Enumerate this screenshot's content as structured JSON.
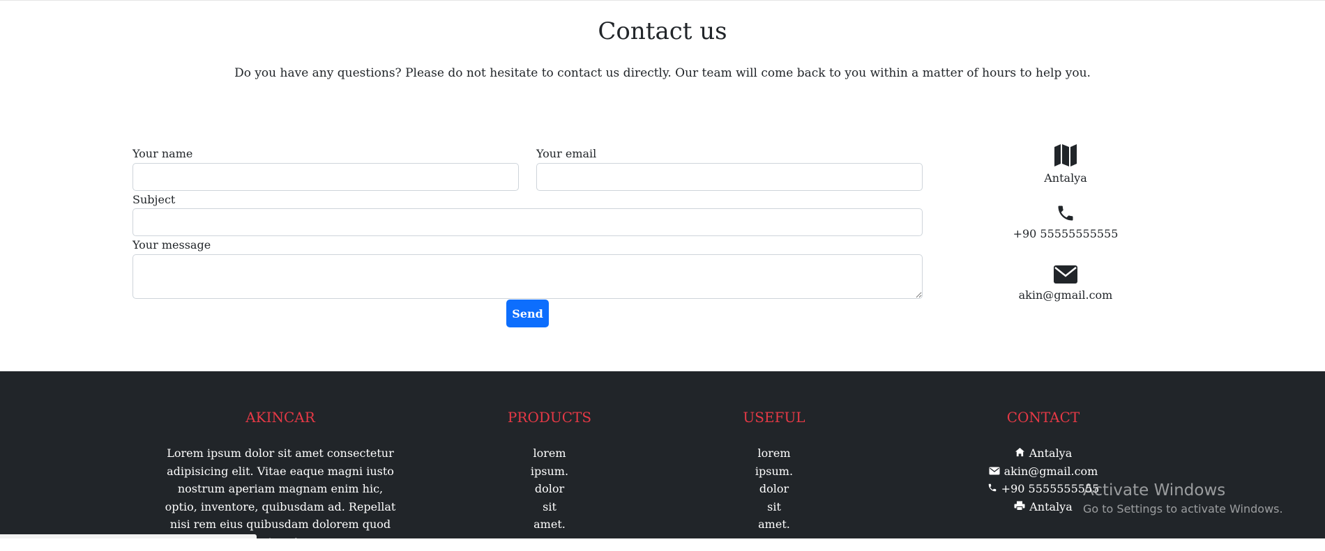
{
  "contact": {
    "title": "Contact us",
    "intro": "Do you have any questions? Please do not hesitate to contact us directly. Our team will come back to you within a matter of hours to help you.",
    "form": {
      "name_label": "Your name",
      "name_value": "",
      "email_label": "Your email",
      "email_value": "",
      "subject_label": "Subject",
      "subject_value": "",
      "message_label": "Your message",
      "message_value": "",
      "send_label": "Send"
    },
    "info": {
      "location": "Antalya",
      "location_icon": "map-icon",
      "phone": "+90 55555555555",
      "phone_icon": "phone-icon",
      "email": "akin@gmail.com",
      "email_icon": "envelope-icon"
    }
  },
  "footer": {
    "about": {
      "heading": "AKINCAR",
      "text": "Lorem ipsum dolor sit amet consectetur adipisicing elit. Vitae eaque magni iusto nostrum aperiam magnam enim hic, optio, inventore, quibusdam ad. Repellat nisi rem eius quibusdam dolorem quod sint a!"
    },
    "products": {
      "heading": "PRODUCTS",
      "items": [
        "lorem",
        "ipsum.",
        "dolor",
        "sit",
        "amet."
      ]
    },
    "useful": {
      "heading": "USEFUL",
      "items": [
        "lorem",
        "ipsum.",
        "dolor",
        "sit",
        "amet."
      ]
    },
    "contact": {
      "heading": "CONTACT",
      "items": [
        {
          "icon": "home-icon",
          "text": "Antalya"
        },
        {
          "icon": "envelope-icon",
          "text": "akin@gmail.com"
        },
        {
          "icon": "phone-icon",
          "text": "+90 5555555555"
        },
        {
          "icon": "print-icon",
          "text": "Antalya"
        }
      ]
    },
    "heading_color": "#e63946",
    "background": "#212529"
  },
  "overlay": {
    "title": "Activate Windows",
    "subtitle": "Go to Settings to activate Windows."
  },
  "colors": {
    "accent": "#0d6efd",
    "text": "#212529"
  }
}
